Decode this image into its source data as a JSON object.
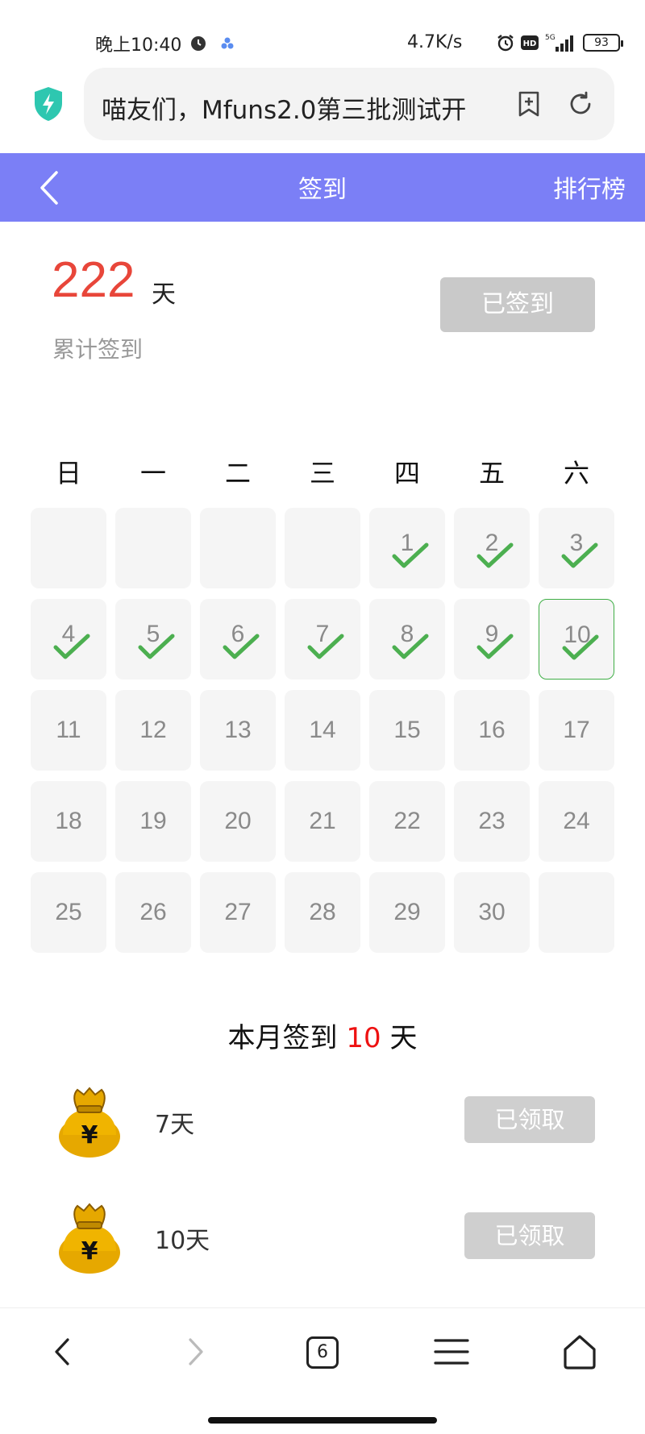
{
  "status_bar": {
    "time": "晚上10:40",
    "net_speed": "4.7K/s",
    "battery": "93",
    "net_type": "5G"
  },
  "browser": {
    "page_title": "喵友们，Mfuns2.0第三批测试开",
    "tab_count": "6"
  },
  "header": {
    "title": "签到",
    "right_link": "排行榜"
  },
  "summary": {
    "total_days": "222",
    "unit": "天",
    "label": "累计签到",
    "signin_button": "已签到"
  },
  "calendar": {
    "weekdays": [
      "日",
      "一",
      "二",
      "三",
      "四",
      "五",
      "六"
    ],
    "days": [
      "1",
      "2",
      "3",
      "4",
      "5",
      "6",
      "7",
      "8",
      "9",
      "10",
      "11",
      "12",
      "13",
      "14",
      "15",
      "16",
      "17",
      "18",
      "19",
      "20",
      "21",
      "22",
      "23",
      "24",
      "25",
      "26",
      "27",
      "28",
      "29",
      "30"
    ],
    "first_weekday_index": 4,
    "signed_days": [
      1,
      2,
      3,
      4,
      5,
      6,
      7,
      8,
      9,
      10
    ],
    "today": 10,
    "check_color": "#4caf50"
  },
  "month_summary": {
    "prefix": "本月签到",
    "count": "10",
    "suffix": "天"
  },
  "rewards": [
    {
      "label": "7天",
      "button": "已领取"
    },
    {
      "label": "10天",
      "button": "已领取"
    }
  ],
  "colors": {
    "header_bg": "#7b7ff6",
    "total_number": "#e8463a",
    "month_count": "#ee1111"
  }
}
